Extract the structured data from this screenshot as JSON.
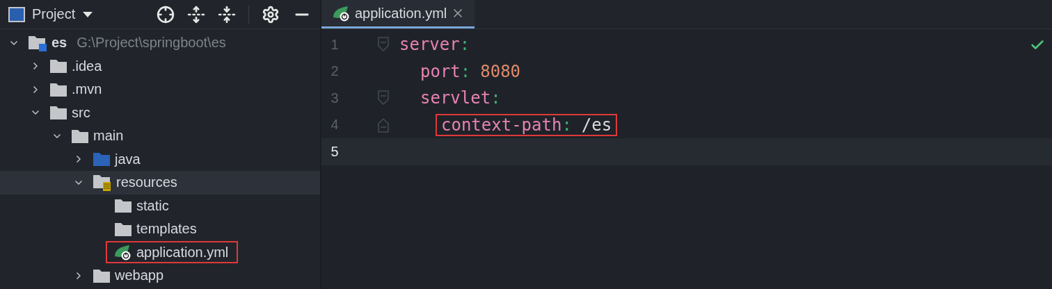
{
  "project_panel": {
    "title": "Project",
    "tree": [
      {
        "label": "es",
        "path": "G:\\Project\\springboot\\es",
        "kind": "module",
        "expanded": true,
        "selected": false,
        "highlighted": false,
        "children": [
          {
            "label": ".idea",
            "kind": "folder",
            "expanded": false,
            "selected": false,
            "highlighted": false
          },
          {
            "label": ".mvn",
            "kind": "folder",
            "expanded": false,
            "selected": false,
            "highlighted": false
          },
          {
            "label": "src",
            "kind": "folder",
            "expanded": true,
            "selected": false,
            "highlighted": false,
            "children": [
              {
                "label": "main",
                "kind": "folder",
                "expanded": true,
                "selected": false,
                "highlighted": false,
                "children": [
                  {
                    "label": "java",
                    "kind": "source-folder",
                    "expanded": false,
                    "selected": false,
                    "highlighted": false
                  },
                  {
                    "label": "resources",
                    "kind": "resources-folder",
                    "expanded": true,
                    "selected": true,
                    "highlighted": false,
                    "children": [
                      {
                        "label": "static",
                        "kind": "folder",
                        "selected": false,
                        "highlighted": false
                      },
                      {
                        "label": "templates",
                        "kind": "folder",
                        "selected": false,
                        "highlighted": false
                      },
                      {
                        "label": "application.yml",
                        "kind": "spring-yml",
                        "selected": false,
                        "highlighted": true
                      }
                    ]
                  },
                  {
                    "label": "webapp",
                    "kind": "folder",
                    "expanded": false,
                    "selected": false,
                    "highlighted": false
                  }
                ]
              }
            ]
          }
        ]
      }
    ]
  },
  "editor": {
    "tabs": [
      {
        "label": "application.yml",
        "selected": true
      }
    ],
    "line_numbers": [
      {
        "label": "1",
        "selected": false
      },
      {
        "label": "2",
        "selected": false
      },
      {
        "label": "3",
        "selected": false
      },
      {
        "label": "4",
        "selected": false
      },
      {
        "label": "5",
        "selected": true
      }
    ],
    "code": [
      {
        "key": "server",
        "separator": ":",
        "highlighted": false,
        "children": [
          {
            "key": "port",
            "separator": ":",
            "value": "8080",
            "kind": "number",
            "highlighted": false
          },
          {
            "key": "servlet",
            "separator": ":",
            "highlighted": false,
            "children": [
              {
                "key": "context-path",
                "separator": ":",
                "value": "/es",
                "kind": "string",
                "highlighted": true
              }
            ]
          }
        ]
      }
    ],
    "inspection_ok": true
  }
}
